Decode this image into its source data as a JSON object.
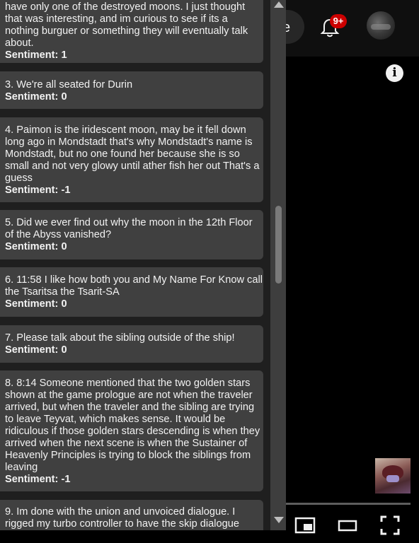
{
  "header": {
    "pill_letter": "e",
    "notification_badge": "9+"
  },
  "player": {
    "info_glyph": "i"
  },
  "comments": [
    {
      "text": "have only one of the destroyed moons. I just thought that was interesting, and im curious to see if its a nothing burguer or something they will eventually talk about.",
      "sentiment": "Sentiment: 1"
    },
    {
      "text": "3. We're all seated for Durin",
      "sentiment": "Sentiment: 0"
    },
    {
      "text": "4. Paimon is the iridescent moon, may be it fell down long ago in Mondstadt that's why Mondstadt's name is Mondstadt, but no one found her because she is so small and not very glowy until ather fish her out That's a guess",
      "sentiment": "Sentiment: -1"
    },
    {
      "text": "5. Did we ever find out why the moon in the 12th Floor of the Abyss vanished?",
      "sentiment": "Sentiment: 0"
    },
    {
      "text": "6. 11:58 I like how both you and My Name For Know call the Tsaritsa the Tsarit-SA",
      "sentiment": "Sentiment: 0"
    },
    {
      "text": "7. Please talk about the sibling outside of the ship!",
      "sentiment": "Sentiment: 0"
    },
    {
      "text": "8. 8:14 Someone mentioned that the two golden stars shown at the game prologue are not when the traveler arrived, but when the traveler and the sibling are trying to leave Teyvat, which makes sense. It would be ridiculous if those golden stars descending is when they arrived when the next scene is when the Sustainer of Heavenly Principles is trying to block the siblings from leaving",
      "sentiment": "Sentiment: -1"
    },
    {
      "text": "9. Im done with the union and unvoiced dialogue. I rigged my turbo controller to have the skip dialogue",
      "sentiment": ""
    }
  ]
}
